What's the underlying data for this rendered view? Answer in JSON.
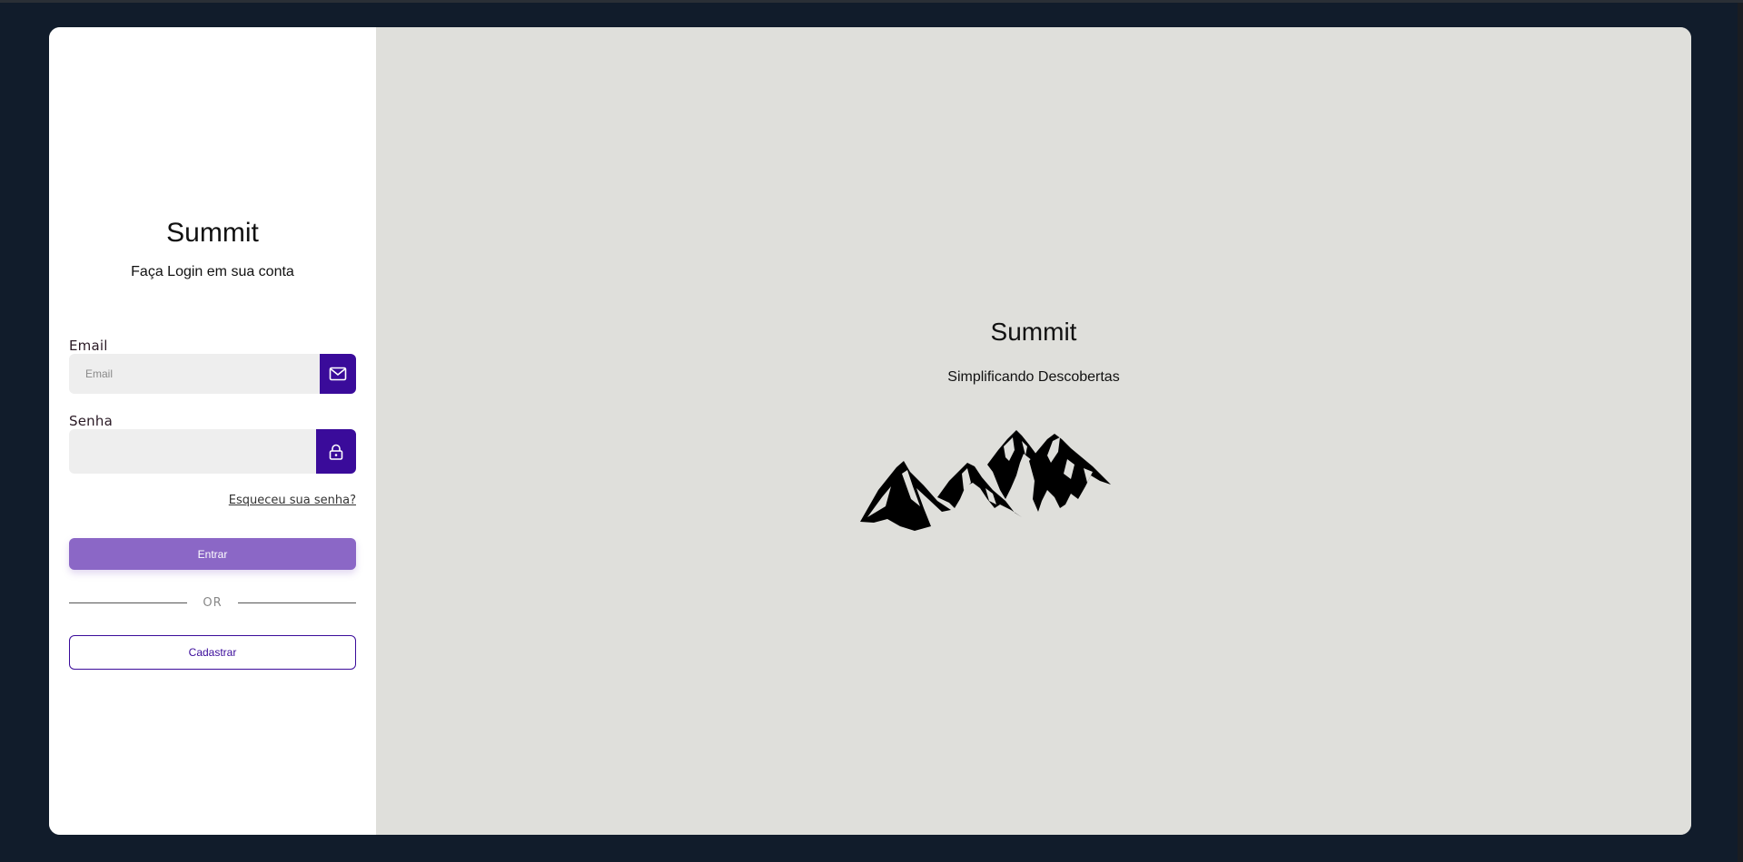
{
  "login": {
    "title": "Summit",
    "subtitle": "Faça Login em sua conta",
    "email_label": "Email",
    "email_placeholder": "Email",
    "email_value": "",
    "password_label": "Senha",
    "password_value": "",
    "forgot_link": "Esqueceu sua senha?",
    "submit_label": "Entrar",
    "divider_text": "OR",
    "register_label": "Cadastrar"
  },
  "brand": {
    "title": "Summit",
    "tagline": "Simplificando Descobertas",
    "illustration": "mountains-illustration"
  },
  "icons": {
    "email": "mail-icon",
    "password": "lock-icon"
  },
  "colors": {
    "page_background": "#111c2b",
    "accent": "#3a0b9a",
    "primary_button": "#8b67c6",
    "panel_background": "#dfdfdb",
    "input_background": "#eeeeee"
  }
}
